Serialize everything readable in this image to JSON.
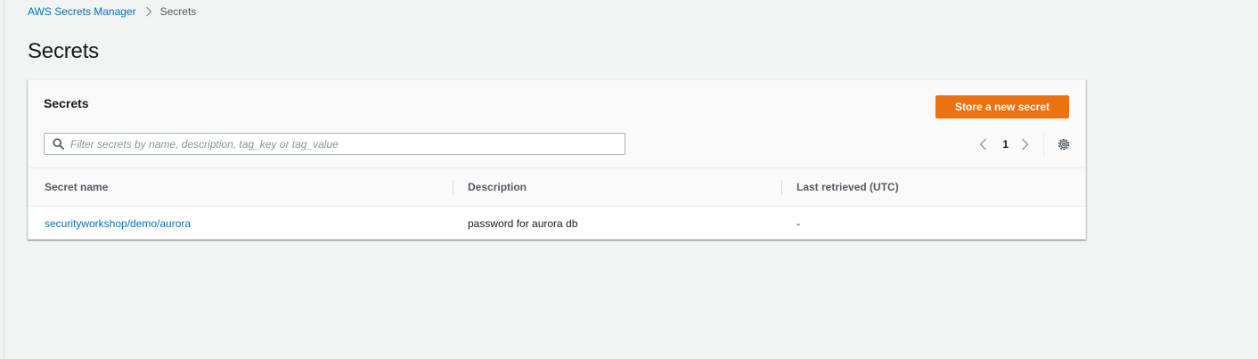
{
  "breadcrumb": {
    "service": "AWS Secrets Manager",
    "current": "Secrets"
  },
  "page": {
    "title": "Secrets"
  },
  "panel": {
    "title": "Secrets",
    "create_button": "Store a new secret",
    "search_placeholder": "Filter secrets by name, description, tag_key or tag_value",
    "search_value": "",
    "pagination": {
      "current_page": "1"
    }
  },
  "table": {
    "columns": [
      "Secret name",
      "Description",
      "Last retrieved (UTC)"
    ],
    "rows": [
      {
        "name": "securityworkshop/demo/aurora",
        "description": "password for aurora db",
        "last_retrieved": "-"
      }
    ]
  },
  "colors": {
    "accent_orange": "#ec7211",
    "link_blue": "#0073bb",
    "page_background": "#f2f3f3"
  },
  "icons": [
    "chevron-right-icon",
    "search-icon",
    "chevron-left-icon",
    "chevron-right-icon",
    "gear-icon"
  ]
}
